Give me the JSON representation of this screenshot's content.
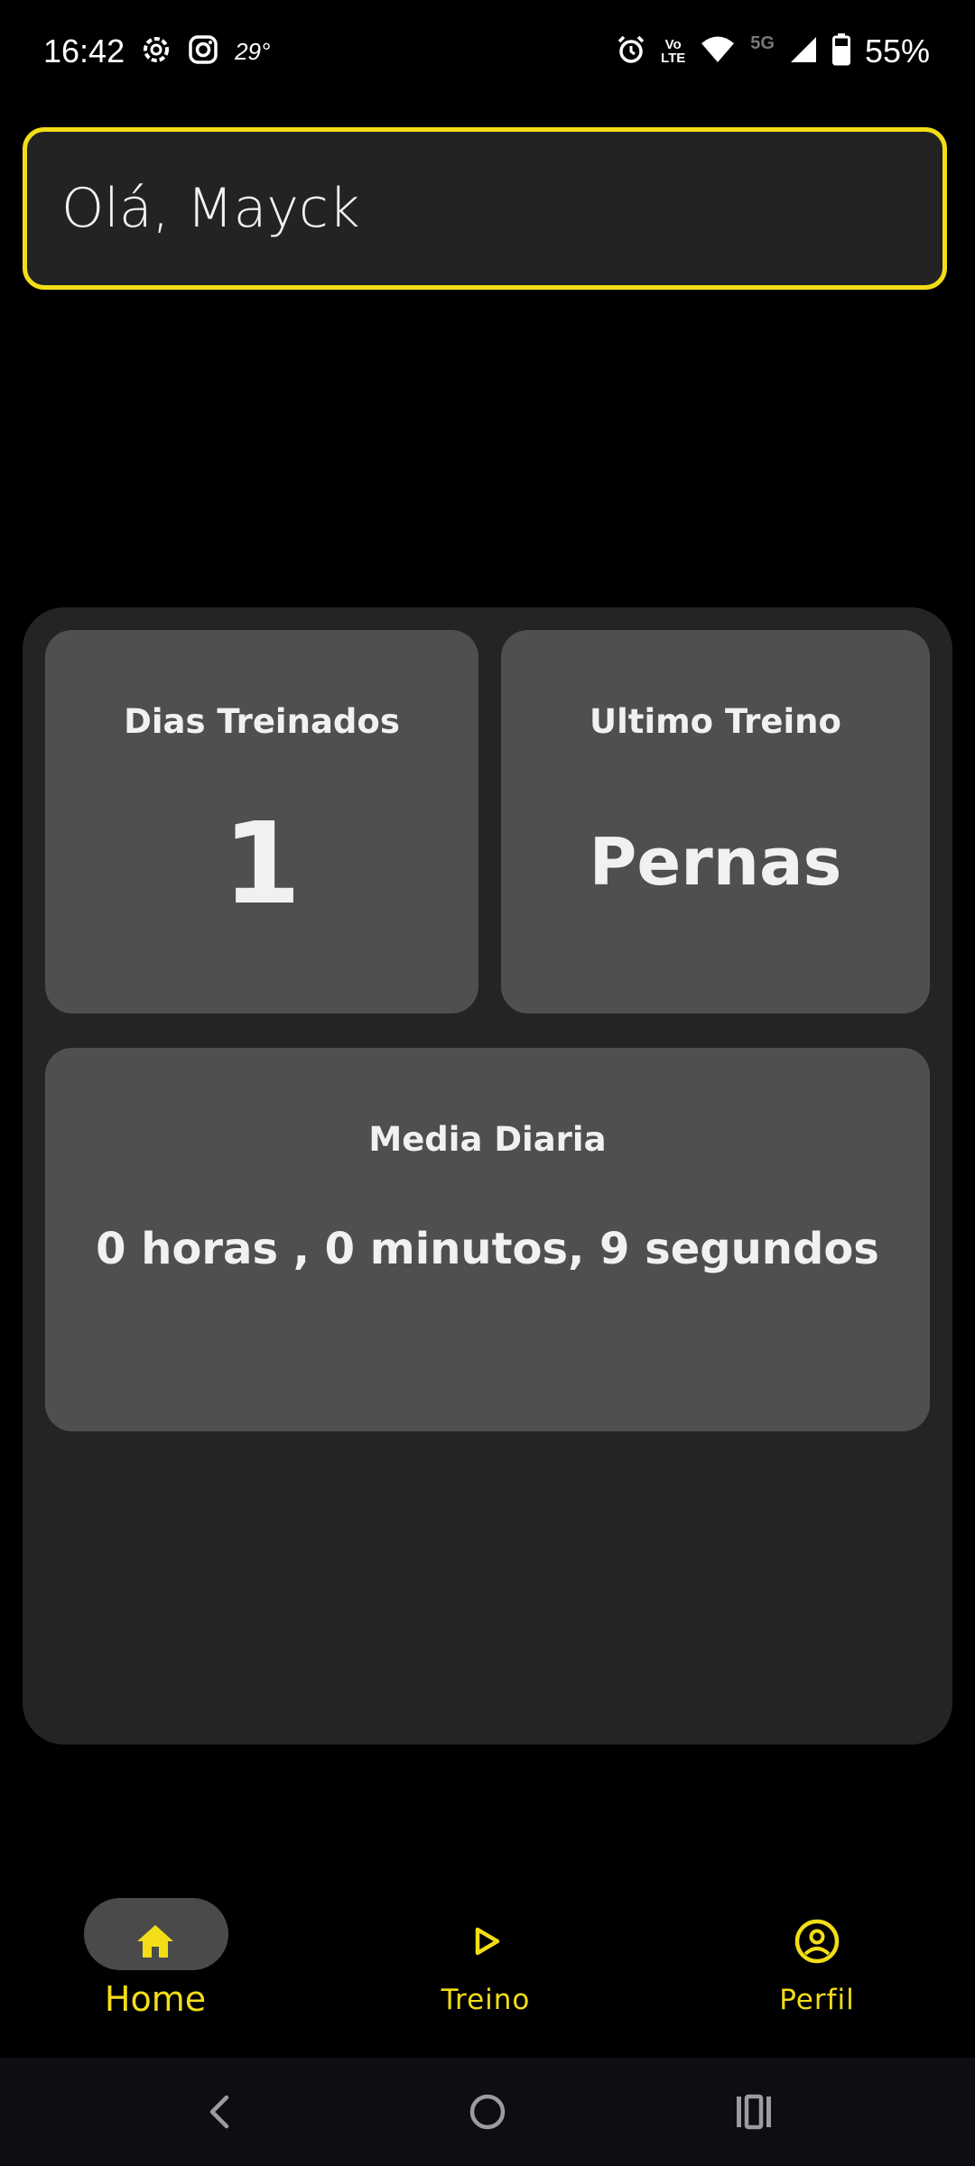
{
  "status_bar": {
    "time": "16:42",
    "temperature": "29°",
    "battery": "55%",
    "network": "5G",
    "volte_line1": "Vo",
    "volte_line2": "LTE"
  },
  "greeting": {
    "text": "Olá, Mayck"
  },
  "stats": {
    "dias_treinados": {
      "title": "Dias Treinados",
      "value": "1"
    },
    "ultimo_treino": {
      "title": "Ultimo Treino",
      "value": "Pernas"
    },
    "media_diaria": {
      "title": "Media Diaria",
      "value": "0 horas , 0 minutos, 9 segundos"
    }
  },
  "bottom_nav": {
    "items": [
      {
        "label": "Home",
        "icon": "home-icon",
        "active": true
      },
      {
        "label": "Treino",
        "icon": "play-icon",
        "active": false
      },
      {
        "label": "Perfil",
        "icon": "profile-icon",
        "active": false
      }
    ]
  },
  "colors": {
    "accent": "#f3dd17",
    "background": "#000000",
    "panel": "#242424",
    "card": "#4f4f4f"
  }
}
